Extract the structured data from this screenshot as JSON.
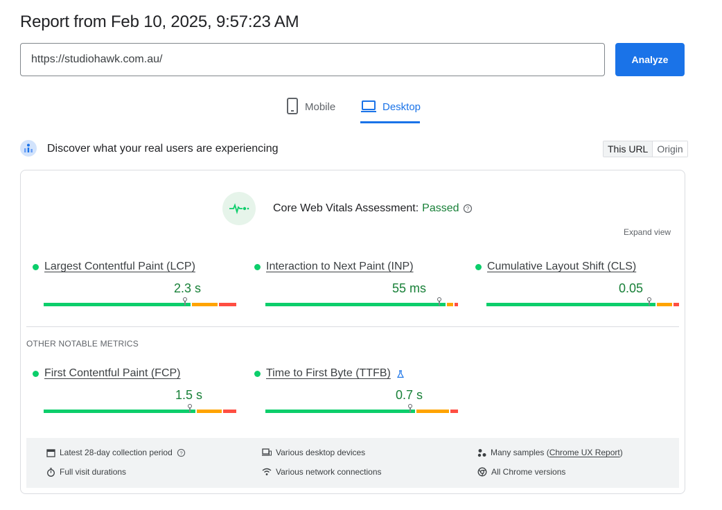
{
  "header": {
    "title": "Report from Feb 10, 2025, 9:57:23 AM",
    "url_value": "https://studiohawk.com.au/",
    "analyze_label": "Analyze"
  },
  "tabs": [
    {
      "label": "Mobile",
      "icon": "phone-icon",
      "active": false
    },
    {
      "label": "Desktop",
      "icon": "laptop-icon",
      "active": true
    }
  ],
  "field_data": {
    "heading": "Discover what your real users are experiencing",
    "toggle": [
      "This URL",
      "Origin"
    ],
    "assessment_label": "Core Web Vitals Assessment:",
    "assessment_status": "Passed",
    "expand_label": "Expand view",
    "colors": {
      "good": "#0cce6b",
      "needs_improvement": "#ffa400",
      "poor": "#ff4e42",
      "value_text": "#188038"
    },
    "core_metrics": [
      {
        "name": "Largest Contentful Paint (LCP)",
        "value": "2.3 s",
        "distribution": [
          0.75,
          0.13,
          0.09
        ]
      },
      {
        "name": "Interaction to Next Paint (INP)",
        "value": "55 ms",
        "distribution": [
          0.95,
          0.03,
          0.02
        ]
      },
      {
        "name": "Cumulative Layout Shift (CLS)",
        "value": "0.05",
        "distribution": [
          0.89,
          0.08,
          0.03
        ]
      }
    ],
    "other_label": "OTHER NOTABLE METRICS",
    "other_metrics": [
      {
        "name": "First Contentful Paint (FCP)",
        "value": "1.5 s",
        "distribution": [
          0.79,
          0.13,
          0.07
        ]
      },
      {
        "name": "Time to First Byte (TTFB)",
        "value": "0.7 s",
        "distribution": [
          0.79,
          0.17,
          0.04
        ]
      }
    ],
    "footer": {
      "col1": [
        "Latest 28-day collection period",
        "Full visit durations"
      ],
      "col2": [
        "Various desktop devices",
        "Various network connections"
      ],
      "col3_prefix": "Many samples (",
      "col3_link": "Chrome UX Report",
      "col3_suffix": ")",
      "col3_b": "All Chrome versions"
    }
  }
}
